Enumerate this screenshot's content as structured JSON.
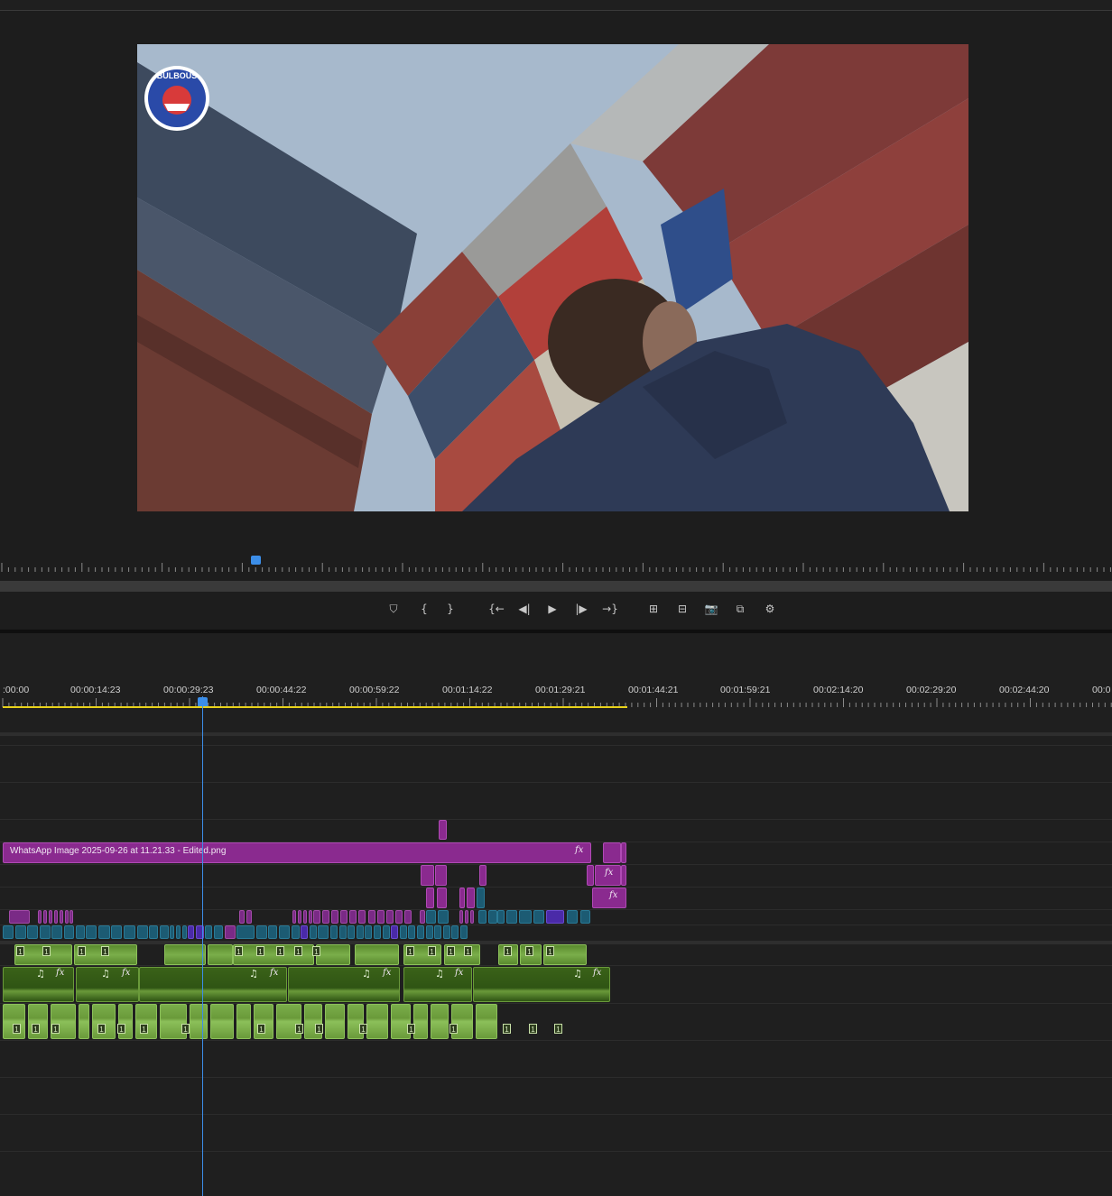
{
  "colors": {
    "accent_blue": "#3c8ee8",
    "video_clip": "#8a2a8f",
    "audio_clip": "#6a9a3a",
    "workarea": "#e8d21a"
  },
  "controls": [
    {
      "name": "add-marker-icon",
      "glyph": "⛉"
    },
    {
      "name": "mark-in-icon",
      "glyph": "{"
    },
    {
      "name": "mark-out-icon",
      "glyph": "}"
    },
    {
      "name": "go-to-in-icon",
      "glyph": "{←"
    },
    {
      "name": "step-back-icon",
      "glyph": "◀|"
    },
    {
      "name": "play-icon",
      "glyph": "▶"
    },
    {
      "name": "step-forward-icon",
      "glyph": "|▶"
    },
    {
      "name": "go-to-out-icon",
      "glyph": "→}"
    },
    {
      "name": "insert-icon",
      "glyph": "⊞"
    },
    {
      "name": "overwrite-icon",
      "glyph": "⊟"
    },
    {
      "name": "export-frame-icon",
      "glyph": "📷"
    },
    {
      "name": "comparison-view-icon",
      "glyph": "⧉"
    },
    {
      "name": "settings-icon",
      "glyph": "⚙"
    }
  ],
  "timeline": {
    "timecodes": [
      ":00:00",
      "00:00:14:23",
      "00:00:29:23",
      "00:00:44:22",
      "00:00:59:22",
      "00:01:14:22",
      "00:01:29:21",
      "00:01:44:21",
      "00:01:59:21",
      "00:02:14:20",
      "00:02:29:20",
      "00:02:44:20",
      "00:0"
    ],
    "main_clip_label": "WhatsApp Image 2025-09-26 at 11.21.33 - Edited.png",
    "fx_label": "fx",
    "music_note": "♫",
    "audio_badge": "1"
  },
  "frame": {
    "logo_text": "BULBOUS"
  }
}
